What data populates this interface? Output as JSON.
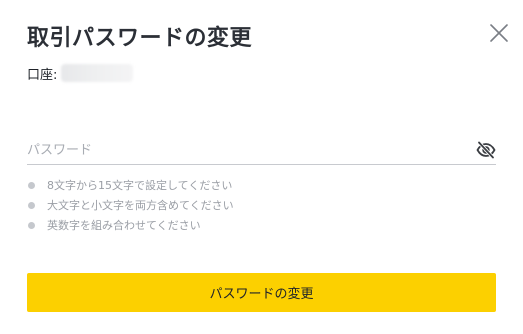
{
  "dialog": {
    "title": "取引パスワードの変更",
    "close_icon": "close-icon"
  },
  "account": {
    "label": "口座:",
    "value": ""
  },
  "password": {
    "placeholder": "パスワード",
    "value": "",
    "visibility_icon": "eye-off-icon"
  },
  "rules": [
    {
      "text": "8文字から15文字で設定してください"
    },
    {
      "text": "大文字と小文字を両方含めてください"
    },
    {
      "text": "英数字を組み合わせてください"
    }
  ],
  "submit": {
    "label": "パスワードの変更"
  },
  "colors": {
    "accent": "#fcd000",
    "title": "#2b2f36",
    "hint": "#9a9ea5",
    "bullet": "#c5c8cd",
    "underline": "#c8cacf"
  }
}
